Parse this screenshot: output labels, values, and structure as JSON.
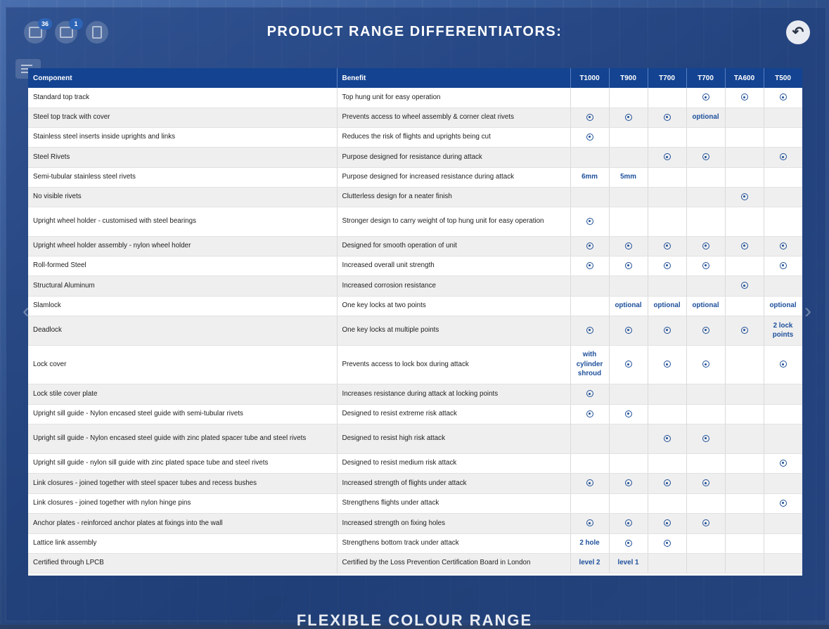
{
  "page": {
    "title": "PRODUCT RANGE DIFFERENTIATORS:",
    "next_section_peek": "FLEXIBLE COLOUR RANGE"
  },
  "toolbar": {
    "gallery_badge": "36",
    "video_badge": "1",
    "icons": [
      "image-gallery-icon",
      "video-icon",
      "brochure-icon",
      "menu-icon",
      "back-arrow-icon",
      "prev-arrow-icon",
      "next-arrow-icon"
    ]
  },
  "colors": {
    "header_bg": "#134391",
    "accent": "#1d4f9b",
    "row_alt": "#efefef"
  },
  "table": {
    "headers": [
      "Component",
      "Benefit",
      "T1000",
      "T900",
      "T700",
      "T700",
      "TA600",
      "T500"
    ],
    "rows": [
      {
        "component": "Standard top track",
        "benefit": "Top hung unit for easy operation",
        "cells": [
          "",
          "",
          "",
          "check",
          "check",
          "check"
        ]
      },
      {
        "component": "Steel top track with cover",
        "benefit": "Prevents access to wheel assembly & corner cleat rivets",
        "cells": [
          "check",
          "check",
          "check",
          "optional",
          "",
          ""
        ]
      },
      {
        "component": "Stainless steel inserts inside uprights and links",
        "benefit": "Reduces the risk of flights and uprights being cut",
        "cells": [
          "check",
          "",
          "",
          "",
          "",
          ""
        ]
      },
      {
        "component": "Steel Rivets",
        "benefit": "Purpose designed for resistance during attack",
        "cells": [
          "",
          "",
          "check",
          "check",
          "",
          "check"
        ]
      },
      {
        "component": "Semi-tubular stainless steel rivets",
        "benefit": "Purpose designed for increased resistance during attack",
        "cells": [
          "6mm",
          "5mm",
          "",
          "",
          "",
          ""
        ]
      },
      {
        "component": "No visible rivets",
        "benefit": "Clutterless design for a neater finish",
        "cells": [
          "",
          "",
          "",
          "",
          "check",
          ""
        ]
      },
      {
        "component": "Upright wheel holder - customised with steel bearings",
        "benefit": "Stronger design to carry weight of top hung unit for easy operation",
        "cells": [
          "check",
          "",
          "",
          "",
          "",
          ""
        ]
      },
      {
        "component": "Upright wheel holder assembly - nylon wheel holder",
        "benefit": "Designed for smooth operation of unit",
        "cells": [
          "check",
          "check",
          "check",
          "check",
          "check",
          "check"
        ]
      },
      {
        "component": "Roll-formed Steel",
        "benefit": "Increased overall unit strength",
        "cells": [
          "check",
          "check",
          "check",
          "check",
          "",
          "check"
        ]
      },
      {
        "component": "Structural Aluminum",
        "benefit": "Increased corrosion resistance",
        "cells": [
          "",
          "",
          "",
          "",
          "check",
          ""
        ]
      },
      {
        "component": "Slamlock",
        "benefit": "One key locks at two points",
        "cells": [
          "",
          "optional",
          "optional",
          "optional",
          "",
          "optional"
        ]
      },
      {
        "component": "Deadlock",
        "benefit": "One key locks at multiple points",
        "cells": [
          "check",
          "check",
          "check",
          "check",
          "check",
          "2 lock points"
        ]
      },
      {
        "component": "Lock cover",
        "benefit": "Prevents access to lock box during attack",
        "cells": [
          "with cylinder shroud",
          "check",
          "check",
          "check",
          "",
          "check"
        ]
      },
      {
        "component": "Lock stile cover plate",
        "benefit": "Increases resistance during attack at locking points",
        "cells": [
          "check",
          "",
          "",
          "",
          "",
          ""
        ]
      },
      {
        "component": "Upright sill guide - Nylon encased steel guide with semi-tubular rivets",
        "benefit": "Designed to resist extreme risk attack",
        "cells": [
          "check",
          "check",
          "",
          "",
          "",
          ""
        ]
      },
      {
        "component": "Upright sill guide - Nylon encased steel guide with zinc plated spacer tube and steel rivets",
        "benefit": "Designed to resist high risk attack",
        "cells": [
          "",
          "",
          "check",
          "check",
          "",
          ""
        ]
      },
      {
        "component": "Upright sill guide - nylon sill guide with zinc plated space tube and steel rivets",
        "benefit": "Designed to resist medium risk attack",
        "cells": [
          "",
          "",
          "",
          "",
          "",
          "check"
        ]
      },
      {
        "component": "Link closures - joined together with steel spacer tubes and recess bushes",
        "benefit": "Increased strength of flights under attack",
        "cells": [
          "check",
          "check",
          "check",
          "check",
          "",
          ""
        ]
      },
      {
        "component": "Link closures - joined together with nylon hinge pins",
        "benefit": "Strengthens flights under attack",
        "cells": [
          "",
          "",
          "",
          "",
          "",
          "check"
        ]
      },
      {
        "component": "Anchor plates - reinforced anchor plates at fixings into the wall",
        "benefit": "Increased strength on fixing holes",
        "cells": [
          "check",
          "check",
          "check",
          "check",
          "",
          ""
        ]
      },
      {
        "component": "Lattice link assembly",
        "benefit": "Strengthens bottom track under attack",
        "cells": [
          "2 hole",
          "check",
          "check",
          "",
          "",
          ""
        ]
      },
      {
        "component": "Certified through LPCB",
        "benefit": "Certified by the Loss Prevention Certification Board in London",
        "cells": [
          "level 2",
          "level 1",
          "",
          "",
          "",
          ""
        ]
      }
    ]
  }
}
